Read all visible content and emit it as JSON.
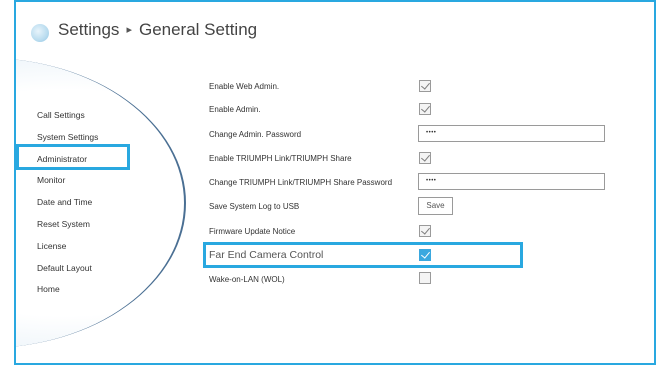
{
  "header": {
    "section": "Settings",
    "separator": "▸",
    "page": "General Setting",
    "icon": "gear-icon"
  },
  "sidebar": {
    "items": [
      {
        "label": "Call Settings"
      },
      {
        "label": "System Settings"
      },
      {
        "label": "Administrator",
        "highlighted": true
      },
      {
        "label": "Monitor"
      },
      {
        "label": "Date and Time"
      },
      {
        "label": "Reset System"
      },
      {
        "label": "License"
      },
      {
        "label": "Default Layout"
      },
      {
        "label": "Home"
      }
    ]
  },
  "settings": {
    "enable_web_admin": {
      "label": "Enable Web Admin.",
      "checked": true
    },
    "enable_admin": {
      "label": "Enable Admin.",
      "checked": true
    },
    "change_admin_password": {
      "label": "Change Admin. Password",
      "value": "••••"
    },
    "enable_triumph_link": {
      "label": "Enable TRIUMPH Link/TRIUMPH Share",
      "checked": true
    },
    "change_triumph_password": {
      "label": "Change TRIUMPH Link/TRIUMPH Share Password",
      "value": "••••"
    },
    "save_log": {
      "label": "Save System Log to USB",
      "button": "Save"
    },
    "firmware_update_notice": {
      "label": "Firmware Update Notice",
      "checked": true
    },
    "far_end_camera_control": {
      "label": "Far End Camera Control",
      "checked": true,
      "highlighted": true
    },
    "wake_on_lan": {
      "label": "Wake-on-LAN (WOL)",
      "checked": false
    }
  },
  "colors": {
    "accent": "#29a8e0",
    "checked_blue": "#3aa8df",
    "text": "#333333"
  }
}
